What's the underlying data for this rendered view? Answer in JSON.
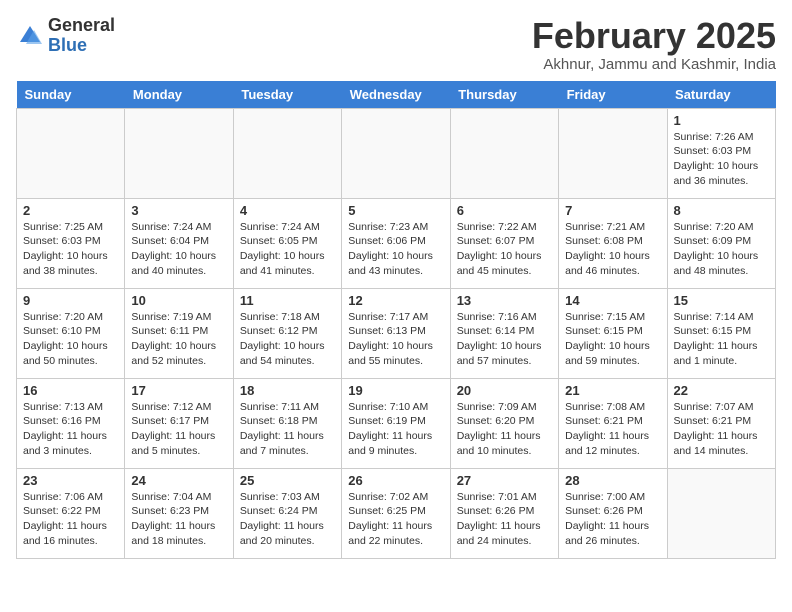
{
  "header": {
    "logo_general": "General",
    "logo_blue": "Blue",
    "month_title": "February 2025",
    "subtitle": "Akhnur, Jammu and Kashmir, India"
  },
  "days_of_week": [
    "Sunday",
    "Monday",
    "Tuesday",
    "Wednesday",
    "Thursday",
    "Friday",
    "Saturday"
  ],
  "weeks": [
    [
      {
        "day": "",
        "info": ""
      },
      {
        "day": "",
        "info": ""
      },
      {
        "day": "",
        "info": ""
      },
      {
        "day": "",
        "info": ""
      },
      {
        "day": "",
        "info": ""
      },
      {
        "day": "",
        "info": ""
      },
      {
        "day": "1",
        "info": "Sunrise: 7:26 AM\nSunset: 6:03 PM\nDaylight: 10 hours and 36 minutes."
      }
    ],
    [
      {
        "day": "2",
        "info": "Sunrise: 7:25 AM\nSunset: 6:03 PM\nDaylight: 10 hours and 38 minutes."
      },
      {
        "day": "3",
        "info": "Sunrise: 7:24 AM\nSunset: 6:04 PM\nDaylight: 10 hours and 40 minutes."
      },
      {
        "day": "4",
        "info": "Sunrise: 7:24 AM\nSunset: 6:05 PM\nDaylight: 10 hours and 41 minutes."
      },
      {
        "day": "5",
        "info": "Sunrise: 7:23 AM\nSunset: 6:06 PM\nDaylight: 10 hours and 43 minutes."
      },
      {
        "day": "6",
        "info": "Sunrise: 7:22 AM\nSunset: 6:07 PM\nDaylight: 10 hours and 45 minutes."
      },
      {
        "day": "7",
        "info": "Sunrise: 7:21 AM\nSunset: 6:08 PM\nDaylight: 10 hours and 46 minutes."
      },
      {
        "day": "8",
        "info": "Sunrise: 7:20 AM\nSunset: 6:09 PM\nDaylight: 10 hours and 48 minutes."
      }
    ],
    [
      {
        "day": "9",
        "info": "Sunrise: 7:20 AM\nSunset: 6:10 PM\nDaylight: 10 hours and 50 minutes."
      },
      {
        "day": "10",
        "info": "Sunrise: 7:19 AM\nSunset: 6:11 PM\nDaylight: 10 hours and 52 minutes."
      },
      {
        "day": "11",
        "info": "Sunrise: 7:18 AM\nSunset: 6:12 PM\nDaylight: 10 hours and 54 minutes."
      },
      {
        "day": "12",
        "info": "Sunrise: 7:17 AM\nSunset: 6:13 PM\nDaylight: 10 hours and 55 minutes."
      },
      {
        "day": "13",
        "info": "Sunrise: 7:16 AM\nSunset: 6:14 PM\nDaylight: 10 hours and 57 minutes."
      },
      {
        "day": "14",
        "info": "Sunrise: 7:15 AM\nSunset: 6:15 PM\nDaylight: 10 hours and 59 minutes."
      },
      {
        "day": "15",
        "info": "Sunrise: 7:14 AM\nSunset: 6:15 PM\nDaylight: 11 hours and 1 minute."
      }
    ],
    [
      {
        "day": "16",
        "info": "Sunrise: 7:13 AM\nSunset: 6:16 PM\nDaylight: 11 hours and 3 minutes."
      },
      {
        "day": "17",
        "info": "Sunrise: 7:12 AM\nSunset: 6:17 PM\nDaylight: 11 hours and 5 minutes."
      },
      {
        "day": "18",
        "info": "Sunrise: 7:11 AM\nSunset: 6:18 PM\nDaylight: 11 hours and 7 minutes."
      },
      {
        "day": "19",
        "info": "Sunrise: 7:10 AM\nSunset: 6:19 PM\nDaylight: 11 hours and 9 minutes."
      },
      {
        "day": "20",
        "info": "Sunrise: 7:09 AM\nSunset: 6:20 PM\nDaylight: 11 hours and 10 minutes."
      },
      {
        "day": "21",
        "info": "Sunrise: 7:08 AM\nSunset: 6:21 PM\nDaylight: 11 hours and 12 minutes."
      },
      {
        "day": "22",
        "info": "Sunrise: 7:07 AM\nSunset: 6:21 PM\nDaylight: 11 hours and 14 minutes."
      }
    ],
    [
      {
        "day": "23",
        "info": "Sunrise: 7:06 AM\nSunset: 6:22 PM\nDaylight: 11 hours and 16 minutes."
      },
      {
        "day": "24",
        "info": "Sunrise: 7:04 AM\nSunset: 6:23 PM\nDaylight: 11 hours and 18 minutes."
      },
      {
        "day": "25",
        "info": "Sunrise: 7:03 AM\nSunset: 6:24 PM\nDaylight: 11 hours and 20 minutes."
      },
      {
        "day": "26",
        "info": "Sunrise: 7:02 AM\nSunset: 6:25 PM\nDaylight: 11 hours and 22 minutes."
      },
      {
        "day": "27",
        "info": "Sunrise: 7:01 AM\nSunset: 6:26 PM\nDaylight: 11 hours and 24 minutes."
      },
      {
        "day": "28",
        "info": "Sunrise: 7:00 AM\nSunset: 6:26 PM\nDaylight: 11 hours and 26 minutes."
      },
      {
        "day": "",
        "info": ""
      }
    ]
  ]
}
